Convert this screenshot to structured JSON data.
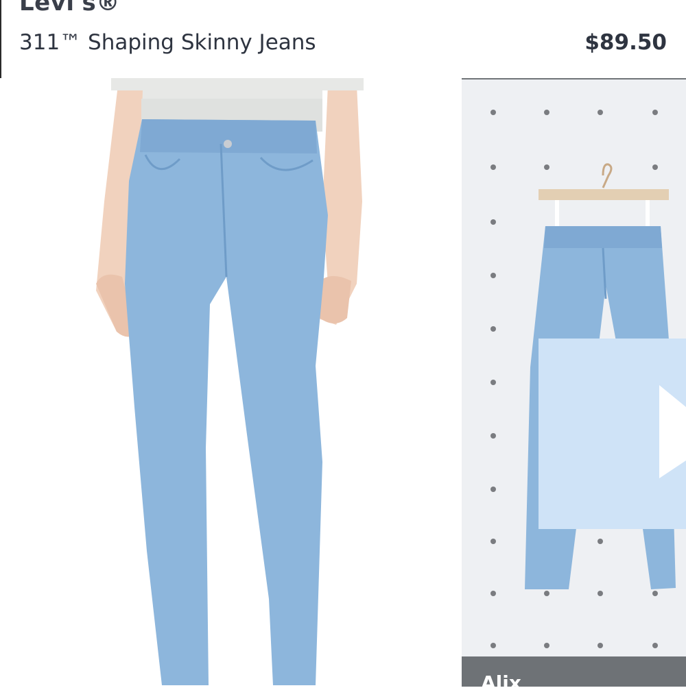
{
  "product": {
    "brand": "Levi's®",
    "title": "311™ Shaping Skinny Jeans",
    "price": "$89.50"
  },
  "gallery": {
    "alt_caption": "Alix",
    "colors": {
      "denim": "#8db6dc",
      "denim_dark": "#6f9cc8",
      "overlay": "#cfe3f7"
    },
    "icons": [
      "play-icon",
      "hanger-icon"
    ]
  }
}
